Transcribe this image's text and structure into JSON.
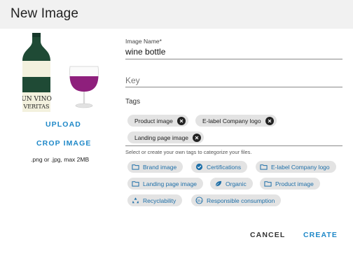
{
  "dialog": {
    "title": "New Image"
  },
  "image_panel": {
    "preview_label_line1": "UN VINO",
    "preview_label_line2": "VERITAS",
    "upload_label": "UPLOAD",
    "crop_label": "CROP IMAGE",
    "format_hint": ".png or .jpg, max 2MB"
  },
  "form": {
    "name": {
      "label": "Image Name*",
      "value": "wine bottle"
    },
    "key": {
      "placeholder": "Key"
    },
    "tags": {
      "label": "Tags",
      "selected": [
        "Product image",
        "E-label Company logo",
        "Landing page image"
      ],
      "helper": "Select or create your own tags to categorize your files.",
      "suggestions": [
        {
          "label": "Brand image",
          "icon": "folder-icon"
        },
        {
          "label": "Certifications",
          "icon": "verified-badge-icon"
        },
        {
          "label": "E-label Company logo",
          "icon": "folder-icon"
        },
        {
          "label": "Landing page image",
          "icon": "folder-icon"
        },
        {
          "label": "Organic",
          "icon": "leaf-icon"
        },
        {
          "label": "Product image",
          "icon": "folder-icon"
        },
        {
          "label": "Recyclability",
          "icon": "recycle-icon"
        },
        {
          "label": "Responsible consumption",
          "icon": "age-restriction-icon"
        }
      ]
    }
  },
  "actions": {
    "cancel": "CANCEL",
    "create": "CREATE"
  },
  "colors": {
    "accent": "#1e88c8",
    "chip_bg": "#e3e3e3",
    "header_bg": "#f1f1f1",
    "wine": "#8e1f7c"
  }
}
